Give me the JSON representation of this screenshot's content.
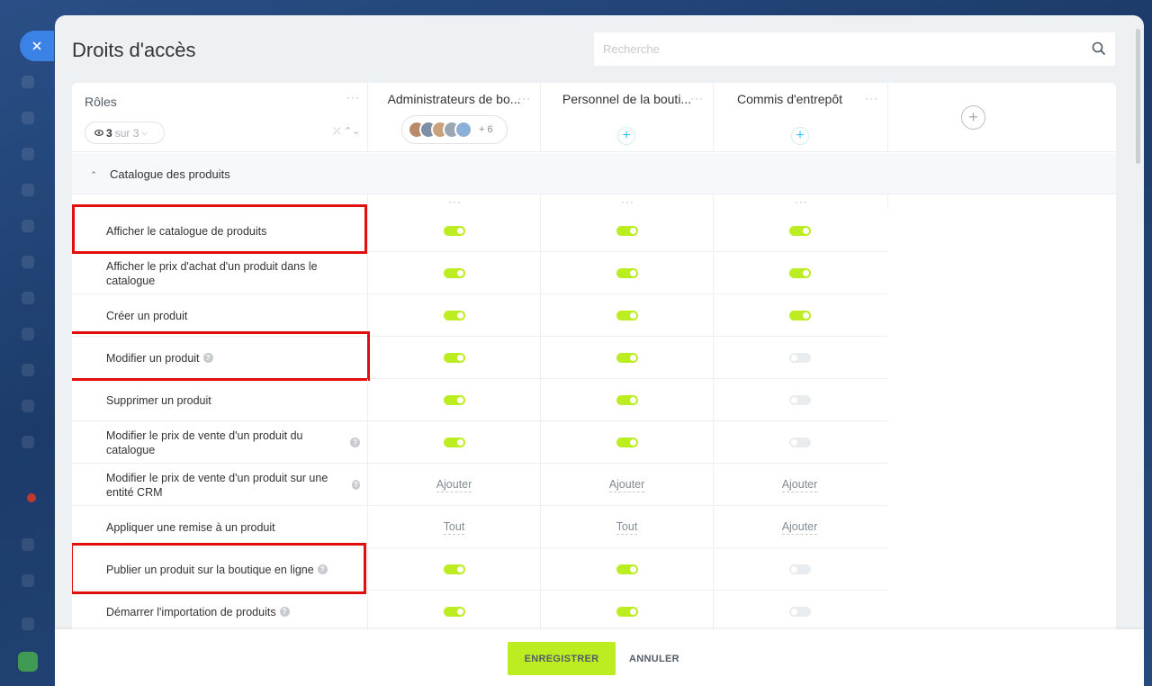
{
  "window": {
    "title": "Droits d'accès"
  },
  "search": {
    "placeholder": "Recherche"
  },
  "roles": {
    "label": "Rôles",
    "filter": {
      "count": "3",
      "suffix": "sur 3"
    }
  },
  "columns": [
    {
      "name": "Administrateurs de bo...",
      "avatars_more": "+ 6"
    },
    {
      "name": "Personnel de la bouti..."
    },
    {
      "name": "Commis d'entrepôt"
    }
  ],
  "section": {
    "title": "Catalogue des produits"
  },
  "permissions": [
    {
      "label": "Afficher le catalogue de produits",
      "help": false,
      "values": [
        "on",
        "on",
        "on"
      ],
      "highlight": true
    },
    {
      "label": "Afficher le prix d'achat d'un produit dans le catalogue",
      "help": false,
      "values": [
        "on",
        "on",
        "on"
      ],
      "highlight": false
    },
    {
      "label": "Créer un produit",
      "help": false,
      "values": [
        "on",
        "on",
        "on"
      ],
      "highlight": false
    },
    {
      "label": "Modifier un produit",
      "help": true,
      "values": [
        "on",
        "on",
        "off"
      ],
      "highlight": true
    },
    {
      "label": "Supprimer un produit",
      "help": false,
      "values": [
        "on",
        "on",
        "off"
      ],
      "highlight": false
    },
    {
      "label": "Modifier le prix de vente d'un produit du catalogue",
      "help": true,
      "values": [
        "on",
        "on",
        "off"
      ],
      "highlight": false
    },
    {
      "label": "Modifier le prix de vente d'un produit sur une entité CRM",
      "help": true,
      "values": [
        "Ajouter",
        "Ajouter",
        "Ajouter"
      ],
      "highlight": false
    },
    {
      "label": "Appliquer une remise à un produit",
      "help": false,
      "values": [
        "Tout",
        "Tout",
        "Ajouter"
      ],
      "highlight": false
    },
    {
      "label": "Publier un produit sur la boutique en ligne",
      "help": true,
      "values": [
        "on",
        "on",
        "off"
      ],
      "highlight": true
    },
    {
      "label": "Démarrer l'importation de produits",
      "help": true,
      "values": [
        "on",
        "on",
        "off"
      ],
      "highlight": false
    }
  ],
  "footer": {
    "save_label": "ENREGISTRER",
    "cancel_label": "ANNULER"
  },
  "colors": {
    "accent": "#bbed21",
    "highlight": "#e20e0e",
    "close": "#3b82e6"
  },
  "icons": {
    "close": "close-icon",
    "search": "search-icon",
    "more": "more-icon",
    "add": "plus-icon",
    "help": "help-icon"
  }
}
